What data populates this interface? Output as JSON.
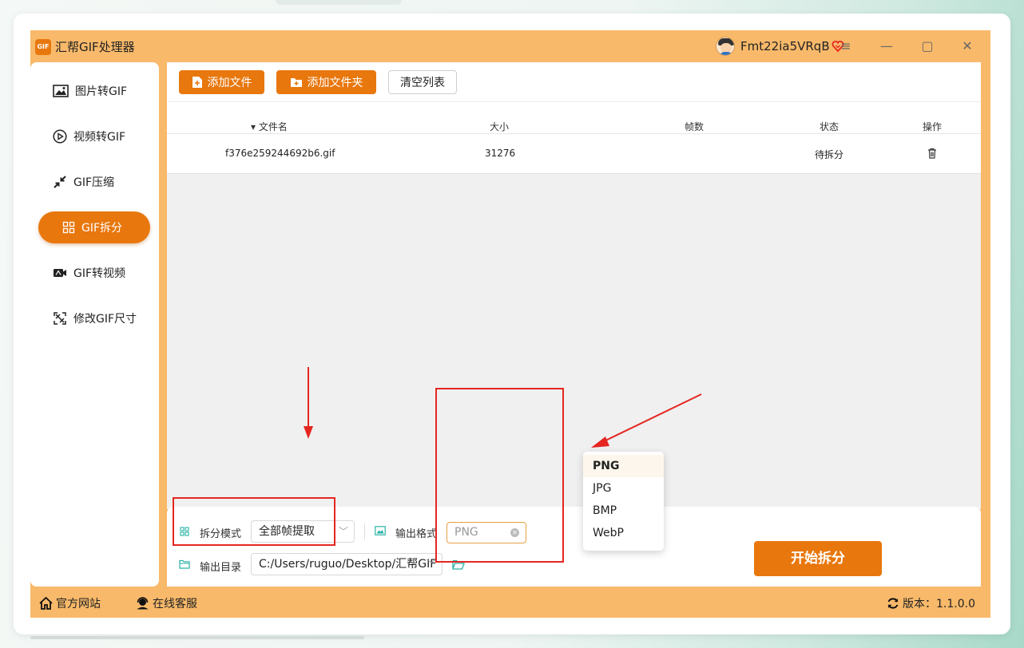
{
  "app": {
    "title": "汇帮GIF处理器",
    "logo_text": "GIF",
    "username": "Fmt22ia5VRqB"
  },
  "window_controls": {
    "menu": "≡",
    "minimize": "—",
    "maximize": "▢",
    "close": "✕"
  },
  "sidebar": {
    "items": [
      {
        "label": "图片转GIF",
        "icon": "image-icon",
        "active": false
      },
      {
        "label": "视频转GIF",
        "icon": "play-icon",
        "active": false
      },
      {
        "label": "GIF压缩",
        "icon": "compress-icon",
        "active": false
      },
      {
        "label": "GIF拆分",
        "icon": "grid-icon",
        "active": true
      },
      {
        "label": "GIF转视频",
        "icon": "video-icon",
        "active": false
      },
      {
        "label": "修改GIF尺寸",
        "icon": "resize-icon",
        "active": false
      }
    ]
  },
  "toolbar": {
    "add_file": "添加文件",
    "add_folder": "添加文件夹",
    "clear_list": "清空列表"
  },
  "table": {
    "columns": [
      "文件名",
      "大小",
      "帧数",
      "状态",
      "操作"
    ],
    "sort_indicator": "▾",
    "rows": [
      {
        "filename": "f376e259244692b6.gif",
        "size": "31276",
        "frames": "",
        "status": "待拆分"
      }
    ]
  },
  "settings": {
    "split_mode_label": "拆分模式",
    "split_mode_value": "全部帧提取",
    "output_format_label": "输出格式",
    "output_format_value": "PNG",
    "output_format_options": [
      "PNG",
      "JPG",
      "BMP",
      "WebP"
    ],
    "output_dir_label": "输出目录",
    "output_dir_value": "C:/Users/ruguo/Desktop/汇帮GIF"
  },
  "start_button": "开始拆分",
  "footer": {
    "website": "官方网站",
    "support": "在线客服",
    "version": "版本：1.1.0.0"
  },
  "colors": {
    "accent": "#e8770d",
    "app_bg": "#f8b96a",
    "annotation_red": "#e52620"
  }
}
